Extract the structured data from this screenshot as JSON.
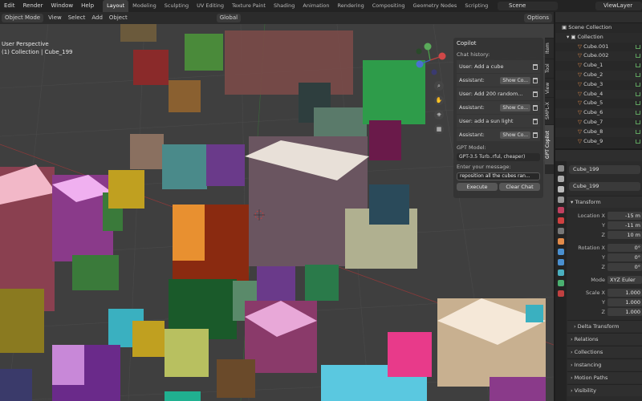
{
  "menu": [
    "Edit",
    "Render",
    "Window",
    "Help"
  ],
  "workspaces": [
    {
      "label": "Layout",
      "active": true
    },
    {
      "label": "Modeling",
      "active": false
    },
    {
      "label": "Sculpting",
      "active": false
    },
    {
      "label": "UV Editing",
      "active": false
    },
    {
      "label": "Texture Paint",
      "active": false
    },
    {
      "label": "Shading",
      "active": false
    },
    {
      "label": "Animation",
      "active": false
    },
    {
      "label": "Rendering",
      "active": false
    },
    {
      "label": "Compositing",
      "active": false
    },
    {
      "label": "Geometry Nodes",
      "active": false
    },
    {
      "label": "Scripting",
      "active": false
    }
  ],
  "scene": "Scene",
  "view_layer": "ViewLayer",
  "viewport_header": {
    "mode": "Object Mode",
    "view": "View",
    "select": "Select",
    "add": "Add",
    "object": "Object",
    "transform": "Global",
    "options": "Options"
  },
  "viewport_info": {
    "line1": "User Perspective",
    "line2": "(1) Collection | Cube_199"
  },
  "copilot": {
    "title": "Copilot",
    "chat_history_label": "Chat history:",
    "history": [
      {
        "text": "User: Add a cube",
        "button": ""
      },
      {
        "text": "Assistant:",
        "button": "Show Co..."
      },
      {
        "text": "User: Add 200 random...",
        "button": ""
      },
      {
        "text": "Assistant:",
        "button": "Show Co..."
      },
      {
        "text": "User: add a sun light",
        "button": ""
      },
      {
        "text": "Assistant:",
        "button": "Show Co..."
      }
    ],
    "model_label": "GPT Model:",
    "model_value": "GPT-3.5 Turb..rful, cheaper)",
    "message_label": "Enter your message:",
    "message_value": "reposition all the cubes ran...",
    "execute": "Execute",
    "clear_chat": "Clear Chat"
  },
  "side_tabs": [
    "Item",
    "Tool",
    "View",
    "SMPL-X",
    "GPT Copilot"
  ],
  "outliner": {
    "scene_collection": "Scene Collection",
    "collection": "Collection",
    "items": [
      "Cube.001",
      "Cube.002",
      "Cube_1",
      "Cube_2",
      "Cube_3",
      "Cube_4",
      "Cube_5",
      "Cube_6",
      "Cube_7",
      "Cube_8",
      "Cube_9"
    ]
  },
  "properties": {
    "object_name": "Cube_199",
    "data_name": "Cube_199",
    "transform": "Transform",
    "location_label": "Location X",
    "location": [
      "-15 m",
      "-11 m",
      "10 m"
    ],
    "rotation_label": "Rotation X",
    "rotation": [
      "0°",
      "0°",
      "0°"
    ],
    "mode_label": "Mode",
    "mode_value": "XYZ Euler",
    "scale_label": "Scale X",
    "scale": [
      "1.000",
      "1.000",
      "1.000"
    ],
    "axis_y": "Y",
    "axis_z": "Z",
    "delta_transform": "Delta Transform",
    "sections": [
      "Relations",
      "Collections",
      "Instancing",
      "Motion Paths",
      "Visibility"
    ]
  },
  "colors": {
    "accent": "#e38b4a",
    "viewport_bg": "#3f3f3f",
    "active_tab": "#3d3d3d"
  }
}
